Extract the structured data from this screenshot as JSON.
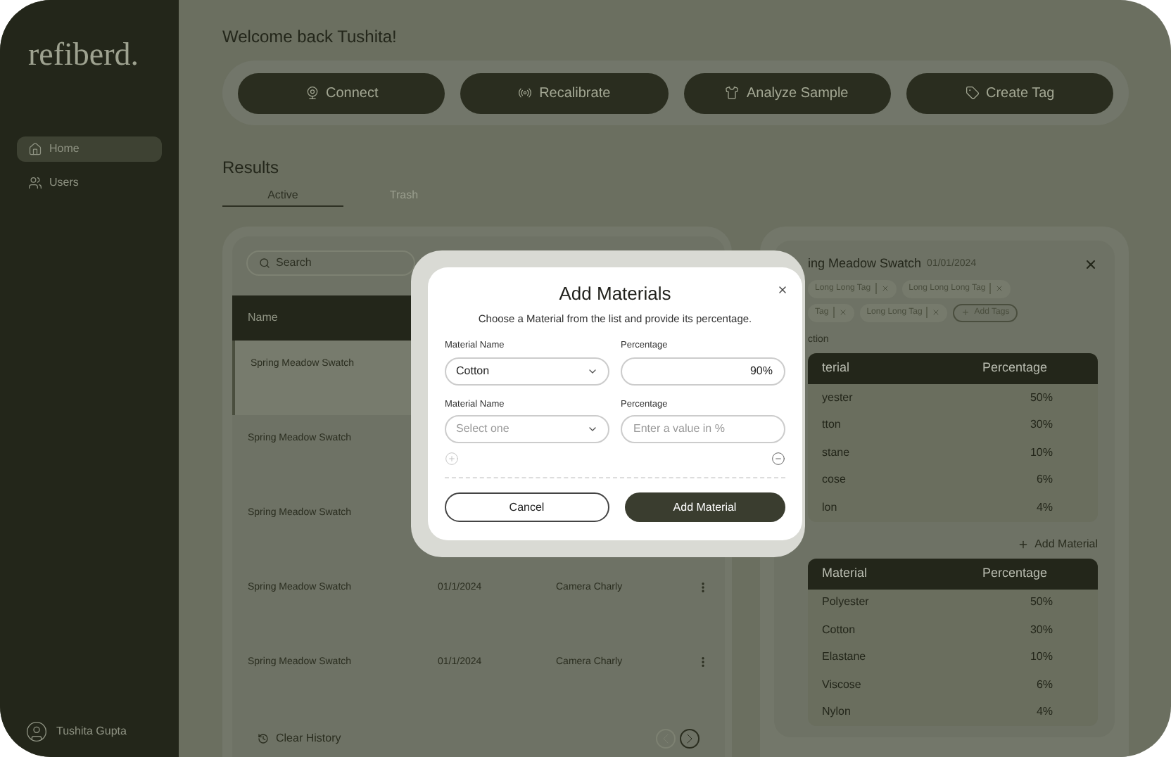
{
  "sidebar": {
    "logo": "refiberd.",
    "items": [
      {
        "label": "Home",
        "selected": true
      },
      {
        "label": "Users",
        "selected": false
      }
    ],
    "user": "Tushita Gupta"
  },
  "welcome": "Welcome back Tushita!",
  "actions": [
    "Connect",
    "Recalibrate",
    "Analyze Sample",
    "Create Tag"
  ],
  "results": {
    "title": "Results",
    "tabs": [
      {
        "label": "Active",
        "selected": true
      },
      {
        "label": "Trash",
        "selected": false
      }
    ]
  },
  "list": {
    "search_placeholder": "Search",
    "columns": [
      "Name"
    ],
    "rows": [
      {
        "name": "Spring Meadow Swatch",
        "selected": true
      },
      {
        "name": "Spring Meadow Swatch",
        "selected": false
      },
      {
        "name": "Spring Meadow Swatch",
        "selected": false
      },
      {
        "name": "Spring Meadow Swatch",
        "date": "01/1/2024",
        "creator": "Camera Charly",
        "selected": false
      },
      {
        "name": "Spring Meadow Swatch",
        "date": "01/1/2024",
        "creator": "Camera Charly",
        "selected": false
      }
    ],
    "clear": "Clear History"
  },
  "detail": {
    "title": "ing Meadow Swatch",
    "date": "01/01/2024",
    "tag_rows": [
      [
        "Long Long Tag",
        "Long Long Long Tag"
      ],
      [
        "Tag",
        "Long Long Tag"
      ]
    ],
    "add_tags": "Add Tags",
    "section": "ction",
    "table1": {
      "columns": [
        "terial",
        "Percentage"
      ],
      "rows": [
        [
          "yester",
          "50%"
        ],
        [
          "tton",
          "30%"
        ],
        [
          "stane",
          "10%"
        ],
        [
          "cose",
          "6%"
        ],
        [
          "lon",
          "4%"
        ]
      ]
    },
    "add_material": "Add Material",
    "table2": {
      "columns": [
        "Material",
        "Percentage"
      ],
      "rows": [
        [
          "Polyester",
          "50%"
        ],
        [
          "Cotton",
          "30%"
        ],
        [
          "Elastane",
          "10%"
        ],
        [
          "Viscose",
          "6%"
        ],
        [
          "Nylon",
          "4%"
        ]
      ]
    }
  },
  "modal": {
    "title": "Add Materials",
    "subtitle": "Choose a Material from the list and provide its percentage.",
    "rows": [
      {
        "name_label": "Material Name",
        "name_value": "Cotton",
        "percent_label": "Percentage",
        "percent_value": "90%"
      },
      {
        "name_label": "Material Name",
        "name_placeholder": "Select one",
        "percent_label": "Percentage",
        "percent_placeholder": "Enter a value in %"
      }
    ],
    "cancel": "Cancel",
    "submit": "Add Material"
  }
}
